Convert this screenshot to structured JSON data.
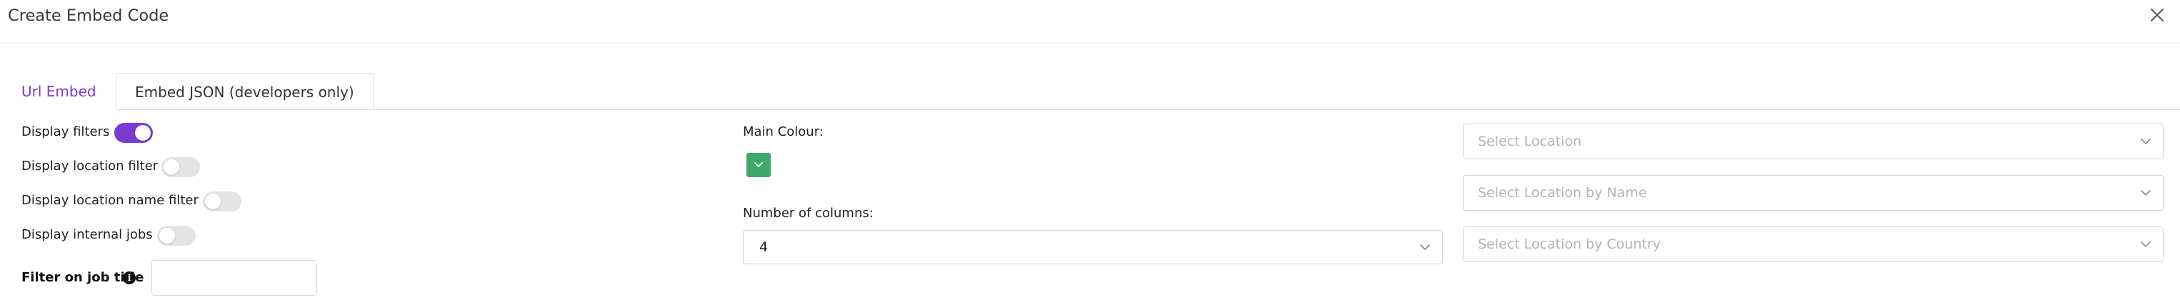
{
  "dialog": {
    "title": "Create Embed Code",
    "close_icon": "close-icon"
  },
  "tabs": [
    {
      "label": "Url Embed",
      "active": true
    },
    {
      "label": "Embed JSON (developers only)",
      "active": false
    }
  ],
  "options": {
    "display_filters": {
      "label": "Display filters",
      "on": true
    },
    "display_location_filter": {
      "label": "Display location filter",
      "on": false
    },
    "display_location_name_filter": {
      "label": "Display location name filter",
      "on": false
    },
    "display_internal_jobs": {
      "label": "Display internal jobs",
      "on": false
    },
    "filter_job_title": {
      "label": "Filter on job title",
      "value": "",
      "info_icon": "info-icon"
    }
  },
  "appearance": {
    "main_colour_label": "Main Colour:",
    "main_colour": "#3fa86a",
    "columns_label": "Number of columns:",
    "columns_value": "4"
  },
  "locations": {
    "select_location_placeholder": "Select Location",
    "select_location_by_name_placeholder": "Select Location by Name",
    "select_location_by_country_placeholder": "Select Location by Country"
  },
  "colors": {
    "accent": "#7b3bd1",
    "toggle_off": "#e4e4e7"
  }
}
